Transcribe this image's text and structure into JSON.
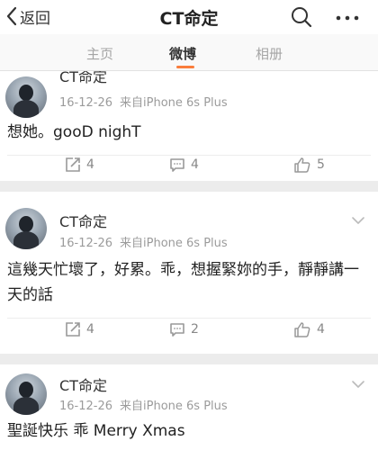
{
  "header": {
    "back_label": "返回",
    "title": "CT命定"
  },
  "tabs": [
    {
      "label": "主页",
      "active": false
    },
    {
      "label": "微博",
      "active": true
    },
    {
      "label": "相册",
      "active": false
    }
  ],
  "accent_color": "#fa7d3c",
  "posts": [
    {
      "username": "CT命定",
      "date": "16-12-26",
      "source": "来自iPhone 6s Plus",
      "content": "想她。gooD nighT",
      "reposts": "4",
      "comments": "4",
      "likes": "5"
    },
    {
      "username": "CT命定",
      "date": "16-12-26",
      "source": "来自iPhone 6s Plus",
      "content": "這幾天忙壞了，好累。乖，想握緊妳的手，靜靜講一天的話",
      "reposts": "4",
      "comments": "2",
      "likes": "4"
    },
    {
      "username": "CT命定",
      "date": "16-12-26",
      "source": "来自iPhone 6s Plus",
      "content": "聖誕快乐 乖  Merry Xmas"
    }
  ]
}
